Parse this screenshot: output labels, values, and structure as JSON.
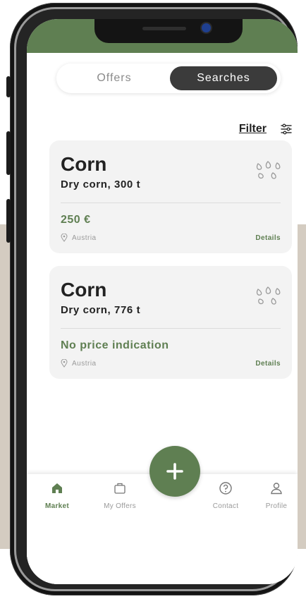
{
  "theme": {
    "accent": "#5f7f52",
    "dark": "#3b3b3b",
    "card_bg": "#f3f3f3",
    "backdrop": "#d4ccc1"
  },
  "toggle": {
    "offers_label": "Offers",
    "searches_label": "Searches",
    "selected": "Searches"
  },
  "filter": {
    "label": "Filter",
    "icon": "sliders-icon"
  },
  "listings": [
    {
      "title": "Corn",
      "subtitle": "Dry corn, 300 t",
      "price": "250 €",
      "location": "Austria",
      "details_label": "Details",
      "icon": "seeds-icon"
    },
    {
      "title": "Corn",
      "subtitle": "Dry corn, 776 t",
      "price": "No price indication",
      "location": "Austria",
      "details_label": "Details",
      "icon": "seeds-icon"
    }
  ],
  "fab": {
    "icon": "plus-icon"
  },
  "nav": [
    {
      "label": "Market",
      "icon": "home-icon",
      "active": true
    },
    {
      "label": "My Offers",
      "icon": "briefcase-icon",
      "active": false
    },
    {
      "label": "Contact",
      "icon": "help-circle-icon",
      "active": false
    },
    {
      "label": "Profile",
      "icon": "user-icon",
      "active": false
    }
  ]
}
